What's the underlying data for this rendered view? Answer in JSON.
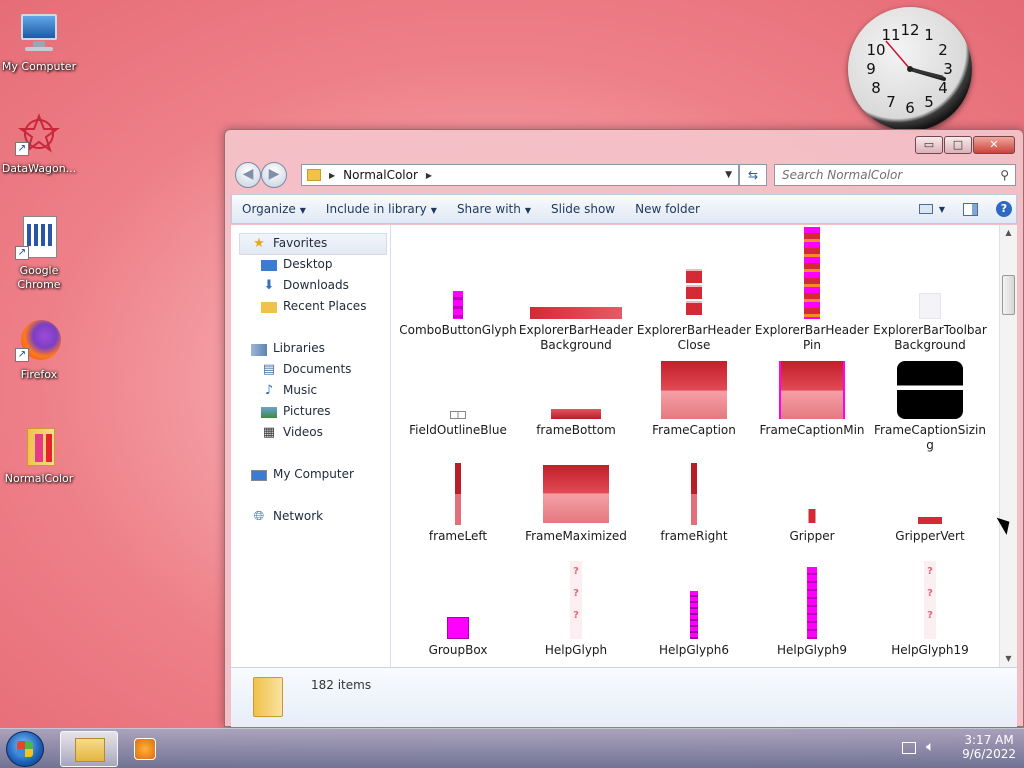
{
  "desktop": {
    "icons": [
      {
        "label": "My Computer",
        "icon": "computer-icon",
        "shortcut": false
      },
      {
        "label": "DataWagon...",
        "icon": "datawagon-icon",
        "shortcut": true
      },
      {
        "label": "Google Chrome",
        "icon": "chrome-icon",
        "shortcut": true
      },
      {
        "label": "Firefox",
        "icon": "firefox-icon",
        "shortcut": true
      },
      {
        "label": "NormalColor",
        "icon": "folder-icon",
        "shortcut": false
      }
    ]
  },
  "clock": {
    "numbers": [
      "12",
      "1",
      "2",
      "3",
      "4",
      "5",
      "6",
      "7",
      "8",
      "9",
      "10",
      "11"
    ],
    "time": "3:17"
  },
  "window": {
    "controls": {
      "minimize": "▭",
      "maximize": "□",
      "close": "✕"
    },
    "address": {
      "path_item": "NormalColor"
    },
    "search": {
      "placeholder": "Search NormalColor"
    },
    "toolbar": {
      "organize": "Organize",
      "include": "Include in library",
      "share": "Share with",
      "slideshow": "Slide show",
      "newfolder": "New folder"
    },
    "nav": {
      "favorites": "Favorites",
      "desktop": "Desktop",
      "downloads": "Downloads",
      "recent": "Recent Places",
      "libraries": "Libraries",
      "documents": "Documents",
      "music": "Music",
      "pictures": "Pictures",
      "videos": "Videos",
      "computer": "My Computer",
      "network": "Network"
    },
    "files": [
      "ComboButtonGlyph",
      "ExplorerBarHeaderBackground",
      "ExplorerBarHeaderClose",
      "ExplorerBarHeaderPin",
      "ExplorerBarToolbarBackground",
      "FieldOutlineBlue",
      "frameBottom",
      "FrameCaption",
      "FrameCaptionMin",
      "FrameCaptionSizing",
      "frameLeft",
      "FrameMaximized",
      "frameRight",
      "Gripper",
      "GripperVert",
      "GroupBox",
      "HelpGlyph",
      "HelpGlyph6",
      "HelpGlyph9",
      "HelpGlyph19"
    ],
    "status": {
      "items": "182 items"
    }
  },
  "taskbar": {
    "time": "3:17 AM",
    "date": "9/6/2022"
  },
  "colors": {
    "accent": "#e8232d",
    "magenta": "#ff00ff",
    "window_frame": "#f3c2c8"
  }
}
